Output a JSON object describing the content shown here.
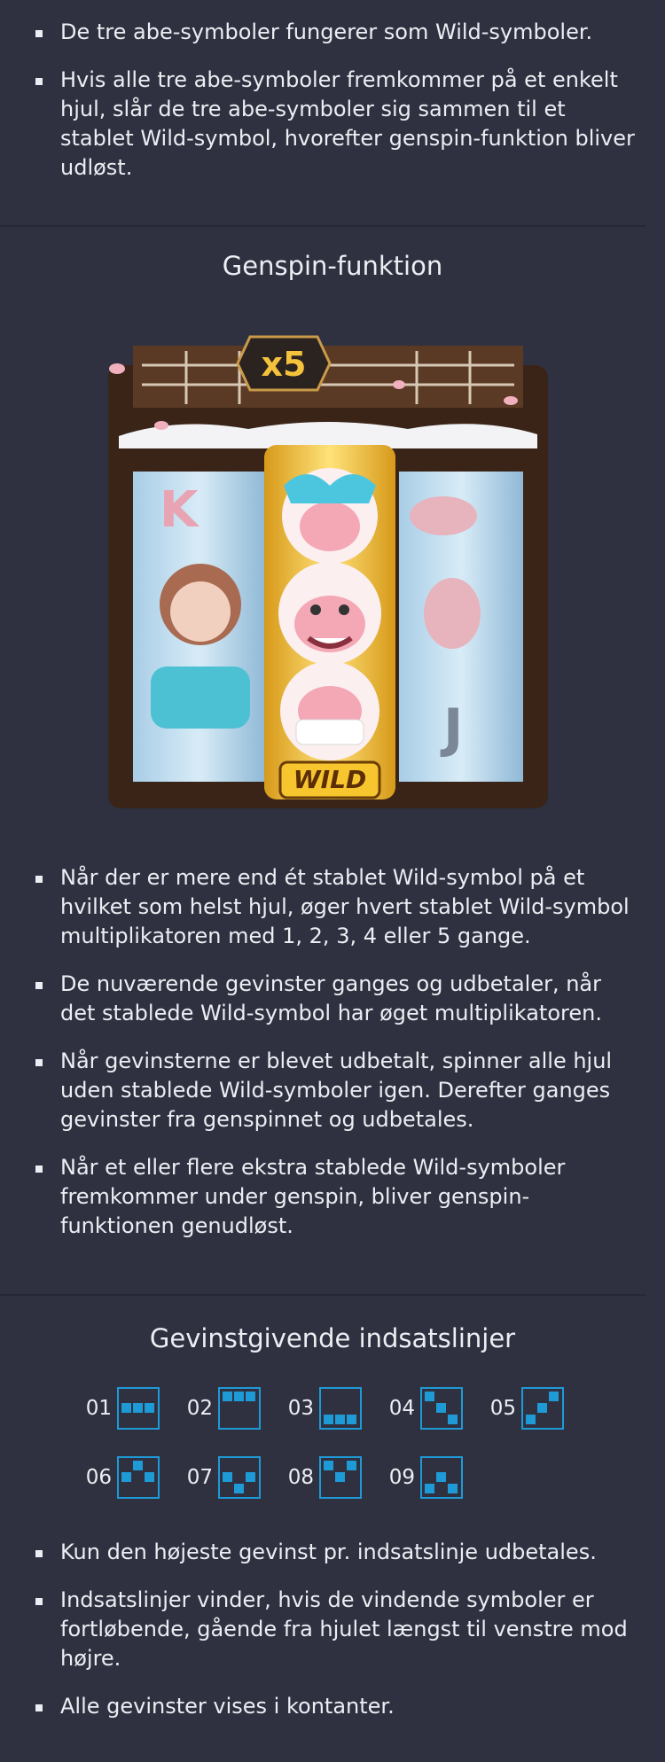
{
  "wild_bullets": [
    "De tre abe-symboler fungerer som Wild-symboler.",
    "Hvis alle tre abe-symboler fremkommer på et enkelt hjul, slår de tre abe-symboler sig sammen til et stablet Wild-symbol, hvorefter genspin-funktion bliver udløst."
  ],
  "genspin": {
    "title": "Genspin-funktion",
    "image": {
      "multiplier_label": "x5",
      "wild_label": "WILD",
      "reel_letters": [
        "K",
        "J"
      ]
    },
    "bullets": [
      "Når der er mere end ét stablet Wild-symbol på et hvilket som helst hjul, øger hvert stablet Wild-symbol multiplikatoren med 1, 2, 3, 4 eller 5 gange.",
      "De nuværende gevinster ganges og udbetaler, når det stablede Wild-symbol har øget multiplikatoren.",
      "Når gevinsterne er blevet udbetalt, spinner alle hjul uden stablede Wild-symboler igen. Derefter ganges gevinster fra genspinnet og udbetales.",
      "Når et eller flere ekstra stablede Wild-symboler fremkommer under genspin, bliver genspin-funktionen genudløst."
    ]
  },
  "paylines": {
    "title": "Gevinstgivende indsatslinjer",
    "lines": [
      {
        "label": "01",
        "rows": [
          1,
          1,
          1
        ]
      },
      {
        "label": "02",
        "rows": [
          0,
          0,
          0
        ]
      },
      {
        "label": "03",
        "rows": [
          2,
          2,
          2
        ]
      },
      {
        "label": "04",
        "rows": [
          0,
          1,
          2
        ]
      },
      {
        "label": "05",
        "rows": [
          2,
          1,
          0
        ]
      },
      {
        "label": "06",
        "rows": [
          1,
          0,
          1
        ]
      },
      {
        "label": "07",
        "rows": [
          1,
          2,
          1
        ]
      },
      {
        "label": "08",
        "rows": [
          0,
          1,
          0
        ]
      },
      {
        "label": "09",
        "rows": [
          2,
          1,
          2
        ]
      }
    ],
    "line_color": "#1e9ad6"
  },
  "final_bullets": [
    "Kun den højeste gevinst pr. indsatslinje udbetales.",
    "Indsatslinjer vinder, hvis de vindende symboler er fortløbende, gående fra hjulet længst til venstre mod højre.",
    "Alle gevinster vises i kontanter."
  ]
}
